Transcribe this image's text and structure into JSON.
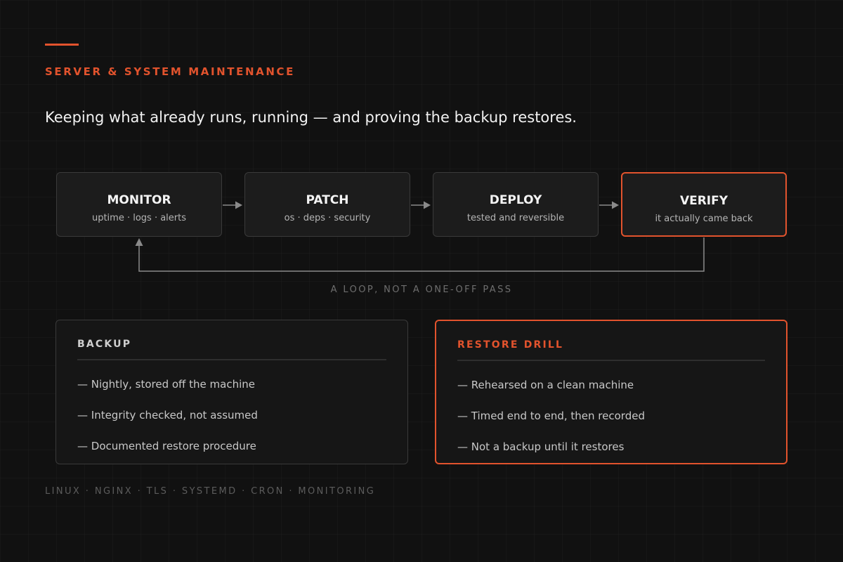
{
  "header": {
    "eyebrow": "SERVER & SYSTEM MAINTENANCE",
    "headline": "Keeping what already runs, running — and proving the backup restores."
  },
  "flow": {
    "steps": [
      {
        "title": "MONITOR",
        "subtitle": "uptime · logs · alerts"
      },
      {
        "title": "PATCH",
        "subtitle": "os · deps · security"
      },
      {
        "title": "DEPLOY",
        "subtitle": "tested and reversible"
      },
      {
        "title": "VERIFY",
        "subtitle": "it actually came back"
      }
    ],
    "loop_label": "A LOOP, NOT A ONE-OFF PASS"
  },
  "cards": {
    "backup": {
      "title": "BACKUP",
      "items": [
        "— Nightly, stored off the machine",
        "— Integrity checked, not assumed",
        "— Documented restore procedure"
      ]
    },
    "restore_drill": {
      "title": "RESTORE DRILL",
      "items": [
        "— Rehearsed on a clean machine",
        "— Timed end to end, then recorded",
        "— Not a backup until it restores"
      ]
    }
  },
  "footer": {
    "stack": "LINUX · NGINX · TLS · SYSTEMD · CRON · MONITORING"
  },
  "colors": {
    "accent": "#e2532d",
    "background": "#111111",
    "box_fill": "#1c1c1c",
    "box_border": "#3a3a3a",
    "connector": "#8a8a8a"
  }
}
